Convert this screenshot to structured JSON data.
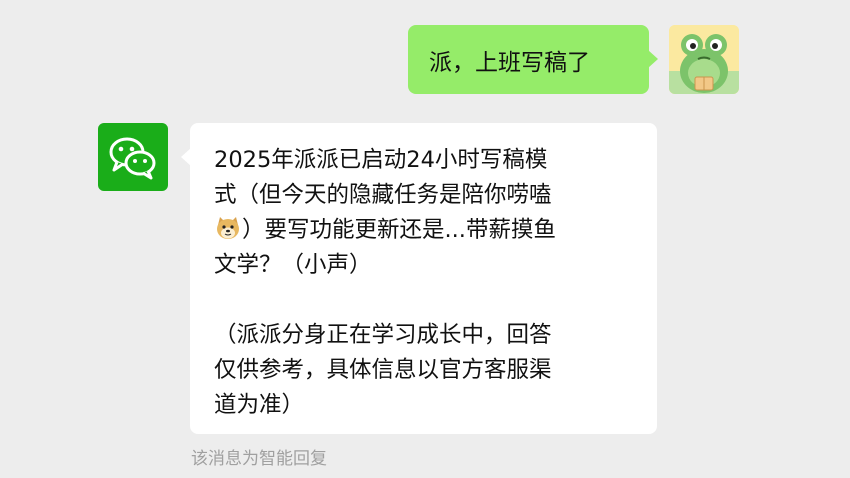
{
  "outgoing": {
    "text": "派，上班写稿了",
    "avatar_icon": "frog-avatar-icon"
  },
  "incoming": {
    "avatar_icon": "wechat-logo-icon",
    "lines": [
      "2025年派派已启动24小时写稿模",
      "式（但今天的隐藏任务是陪你唠嗑",
      "）要写功能更新还是...带薪摸鱼",
      "文学？（小声）",
      "（派派分身正在学习成长中，回答",
      "仅供参考，具体信息以官方客服渠",
      "道为准）"
    ],
    "emoji_icon": "doge-emoji-icon"
  },
  "footnote": "该消息为智能回复",
  "colors": {
    "background": "#ededed",
    "outgoing_bubble": "#95ec69",
    "incoming_bubble": "#ffffff",
    "bot_avatar": "#1aad19",
    "footnote_text": "#a0a0a0"
  }
}
